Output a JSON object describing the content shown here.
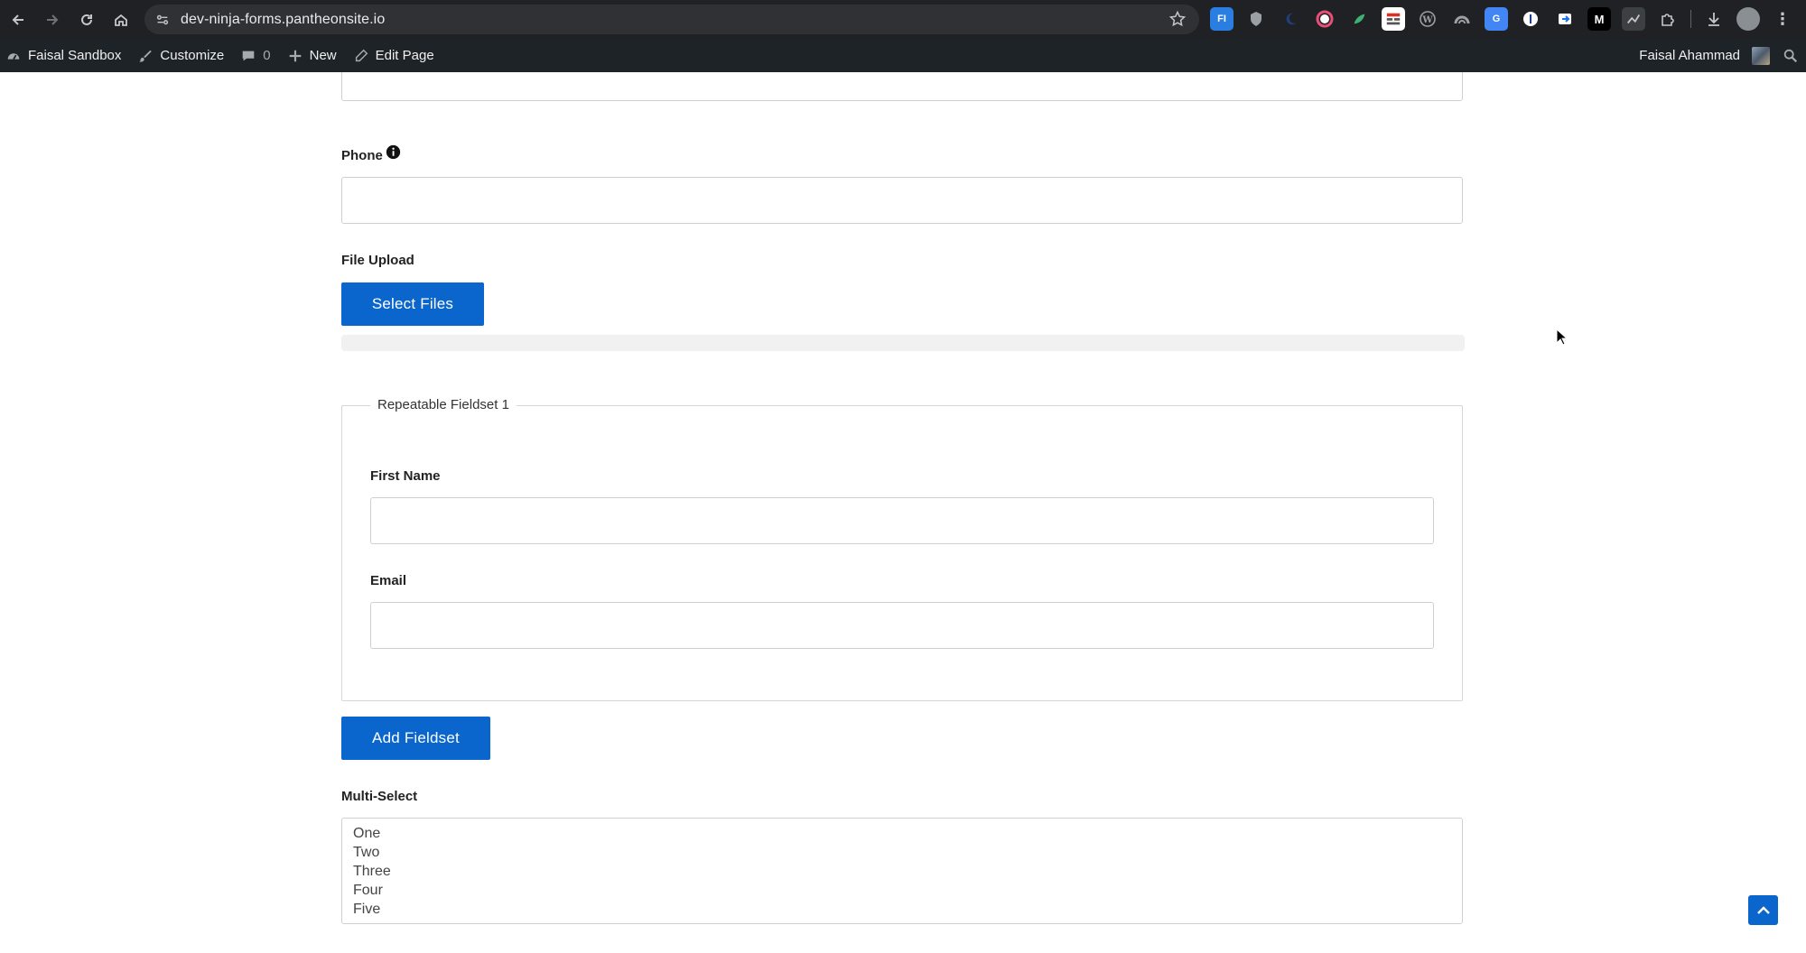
{
  "browser": {
    "url": "dev-ninja-forms.pantheonsite.io",
    "extensions": [
      "fi-extension-icon",
      "shield-extension-icon",
      "moon-extension-icon",
      "color-picker-extension-icon",
      "leaf-extension-icon",
      "grid-extension-icon",
      "wordpress-extension-icon",
      "rainbow-extension-icon",
      "translate-extension-icon",
      "password-manager-extension-icon",
      "tab-extension-icon",
      "m-extension-icon",
      "chart-extension-icon",
      "puzzle-extension-icon"
    ]
  },
  "adminbar": {
    "site_name": "Faisal Sandbox",
    "customize": "Customize",
    "comments_count": "0",
    "new": "New",
    "edit_page": "Edit Page",
    "user_name": "Faisal Ahammad"
  },
  "form": {
    "phone_label": "Phone",
    "file_upload_label": "File Upload",
    "select_files_button": "Select Files",
    "fieldset_legend": "Repeatable Fieldset 1",
    "first_name_label": "First Name",
    "email_label": "Email",
    "add_fieldset_button": "Add Fieldset",
    "multiselect_label": "Multi-Select",
    "multiselect_options": [
      "One",
      "Two",
      "Three",
      "Four",
      "Five"
    ]
  },
  "colors": {
    "primary_button": "#0a66cc",
    "adminbar_bg": "#1d2327",
    "chrome_bg": "#202124"
  }
}
